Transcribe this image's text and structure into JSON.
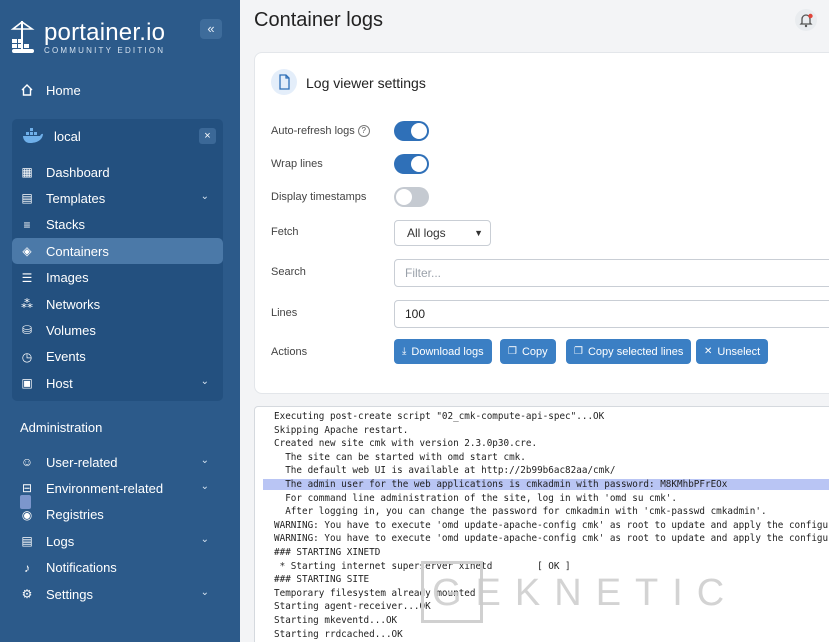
{
  "sidebar": {
    "brand_name": "portainer.io",
    "brand_sub": "COMMUNITY EDITION",
    "collapse": "«",
    "home": "Home",
    "env_name": "local",
    "env_close": "×",
    "env_items": [
      {
        "label": "Dashboard",
        "chevron": ""
      },
      {
        "label": "Templates",
        "chevron": "⌄"
      },
      {
        "label": "Stacks",
        "chevron": ""
      },
      {
        "label": "Containers",
        "chevron": ""
      },
      {
        "label": "Images",
        "chevron": ""
      },
      {
        "label": "Networks",
        "chevron": ""
      },
      {
        "label": "Volumes",
        "chevron": ""
      },
      {
        "label": "Events",
        "chevron": ""
      },
      {
        "label": "Host",
        "chevron": "⌄"
      }
    ],
    "admin_title": "Administration",
    "admin_items": [
      {
        "label": "User-related",
        "chevron": "⌄"
      },
      {
        "label": "Environment-related",
        "chevron": "⌄"
      },
      {
        "label": "Registries",
        "chevron": ""
      },
      {
        "label": "Logs",
        "chevron": "⌄"
      },
      {
        "label": "Notifications",
        "chevron": ""
      },
      {
        "label": "Settings",
        "chevron": "⌄"
      }
    ]
  },
  "header": {
    "title": "Container logs"
  },
  "settings": {
    "title": "Log viewer settings",
    "auto_refresh_label": "Auto-refresh logs",
    "auto_refresh": true,
    "wrap_lines_label": "Wrap lines",
    "wrap_lines": true,
    "timestamps_label": "Display timestamps",
    "timestamps": false,
    "fetch_label": "Fetch",
    "fetch_value": "All logs",
    "search_label": "Search",
    "search_placeholder": "Filter...",
    "lines_label": "Lines",
    "lines_value": "100",
    "actions_label": "Actions",
    "buttons": {
      "download": "Download logs",
      "copy": "Copy",
      "copy_selected": "Copy selected lines",
      "unselect": "Unselect"
    }
  },
  "log_lines": [
    "Executing post-create script \"02_cmk-compute-api-spec\"...OK",
    "Skipping Apache restart.",
    "Created new site cmk with version 2.3.0p30.cre.",
    "  The site can be started with omd start cmk.",
    "  The default web UI is available at http://2b99b6ac82aa/cmk/",
    "  The admin user for the web applications is cmkadmin with password: M8KMhbPFrEOx",
    "  For command line administration of the site, log in with 'omd su cmk'.",
    "  After logging in, you can change the password for cmkadmin with 'cmk-passwd cmkadmin'.",
    "WARNING: You have to execute 'omd update-apache-config cmk' as root to update and apply the configuration",
    "WARNING: You have to execute 'omd update-apache-config cmk' as root to update and apply the configuration",
    "### STARTING XINETD",
    " * Starting internet superserver xinetd        [ OK ]",
    "### STARTING SITE",
    "Temporary filesystem already mounted",
    "Starting agent-receiver...OK",
    "Starting mkeventd...OK",
    "Starting rrdcached...OK"
  ],
  "watermark": "GEKNETIC",
  "colors": {
    "sidebar": "#2c5a8a",
    "accent": "#3b7fc4",
    "highlight": "#b9c5f4"
  }
}
